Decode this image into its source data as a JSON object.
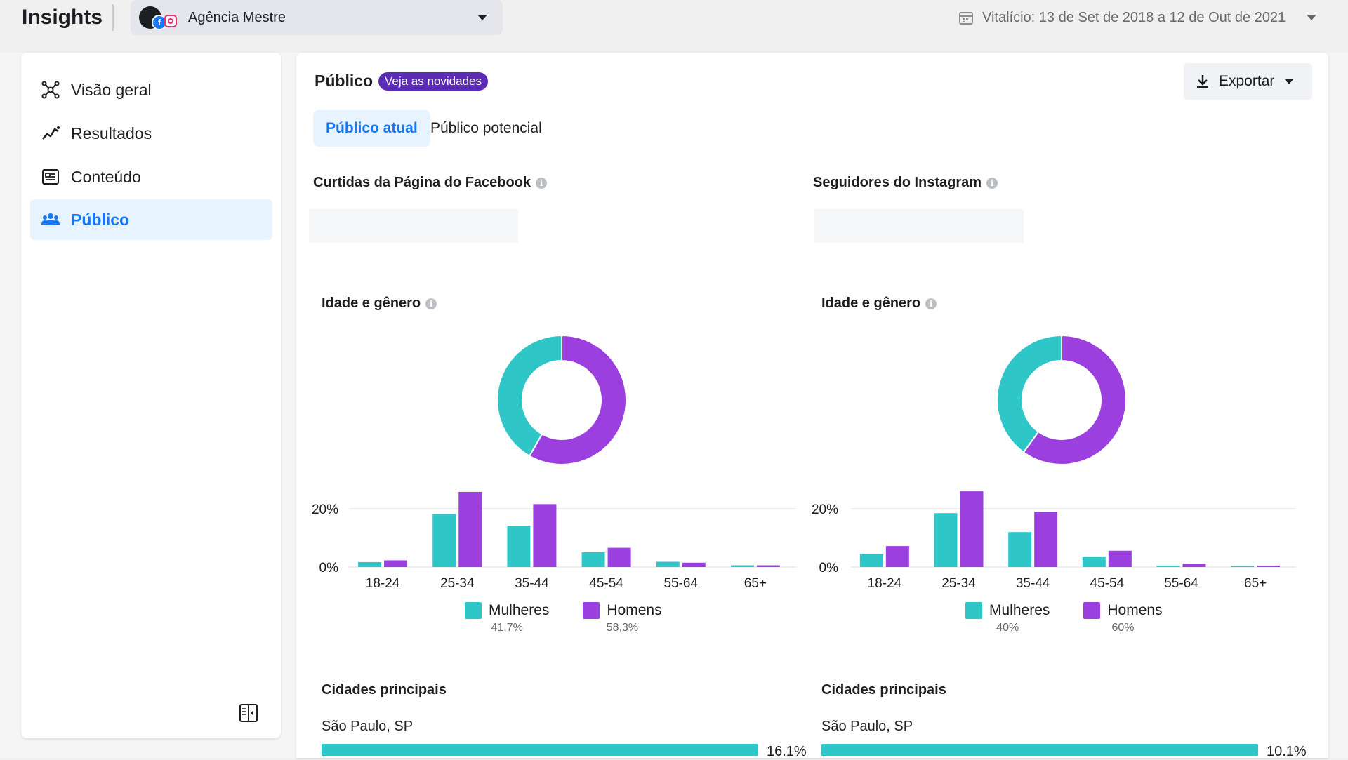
{
  "header": {
    "brand": "Insights",
    "account_name": "Agência Mestre",
    "date_range": "Vitalício: 13 de Set de 2018 a 12 de Out de 2021"
  },
  "sidebar": {
    "items": [
      {
        "label": "Visão geral",
        "icon": "overview-icon",
        "active": false
      },
      {
        "label": "Resultados",
        "icon": "results-icon",
        "active": false
      },
      {
        "label": "Conteúdo",
        "icon": "content-icon",
        "active": false
      },
      {
        "label": "Público",
        "icon": "audience-icon",
        "active": true
      }
    ],
    "collapse_icon": "collapse-sidebar-icon"
  },
  "main": {
    "title": "Público",
    "badge": "Veja as novidades",
    "export_label": "Exportar",
    "tabs": [
      {
        "label": "Público atual",
        "active": true
      },
      {
        "label": "Público potencial",
        "active": false
      }
    ],
    "facebook": {
      "title": "Curtidas da Página do Facebook",
      "age_gender_title": "Idade e gênero",
      "women_label": "Mulheres",
      "men_label": "Homens",
      "women_pct": "41,7%",
      "men_pct": "58,3%",
      "cities_title": "Cidades principais",
      "top_city": "São Paulo, SP",
      "top_city_pct": "16.1%"
    },
    "instagram": {
      "title": "Seguidores do Instagram",
      "age_gender_title": "Idade e gênero",
      "women_label": "Mulheres",
      "men_label": "Homens",
      "women_pct": "40%",
      "men_pct": "60%",
      "cities_title": "Cidades principais",
      "top_city": "São Paulo, SP",
      "top_city_pct": "10.1%"
    }
  },
  "colors": {
    "women": "#2ec6c6",
    "men": "#9b3fdf",
    "accent": "#1877f2",
    "badge": "#5b2bb5"
  },
  "chart_data": [
    {
      "type": "bar",
      "categories": [
        "18-24",
        "25-34",
        "35-44",
        "45-54",
        "55-64",
        "65+"
      ],
      "series": [
        {
          "name": "Mulheres",
          "values": [
            1.7,
            18.2,
            14.2,
            5.1,
            1.8,
            0.6
          ]
        },
        {
          "name": "Homens",
          "values": [
            2.3,
            25.8,
            21.6,
            6.6,
            1.5,
            0.6
          ]
        }
      ],
      "yticks": [
        "0%",
        "20%"
      ],
      "ylim": [
        0,
        25.8
      ],
      "donut": {
        "Mulheres": 41.7,
        "Homens": 58.3
      }
    },
    {
      "type": "bar",
      "categories": [
        "18-24",
        "25-34",
        "35-44",
        "45-54",
        "55-64",
        "65+"
      ],
      "series": [
        {
          "name": "Mulheres",
          "values": [
            4.5,
            18.5,
            12.0,
            3.4,
            0.5,
            0.2
          ]
        },
        {
          "name": "Homens",
          "values": [
            7.2,
            26.0,
            19.0,
            5.6,
            1.1,
            0.5
          ]
        }
      ],
      "yticks": [
        "0%",
        "20%"
      ],
      "ylim": [
        0,
        26.0
      ],
      "donut": {
        "Mulheres": 40,
        "Homens": 60
      }
    }
  ]
}
